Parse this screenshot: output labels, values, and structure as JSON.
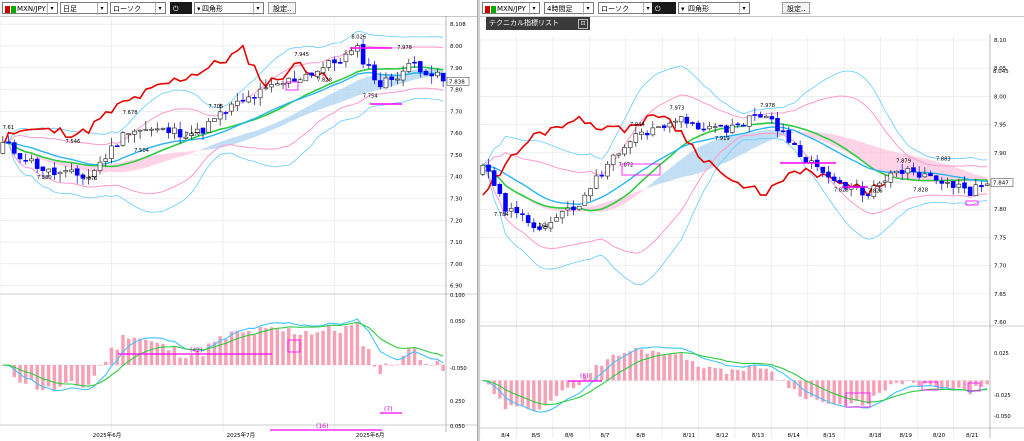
{
  "left": {
    "toolbar": {
      "symbol": "MXN/JPY",
      "timeframe": "日足",
      "chart_style": "ローソク",
      "tool": "四角形",
      "settings_label": "設定.."
    },
    "bottom_labels": [
      "(42)",
      "(16)",
      "(7)"
    ]
  },
  "right": {
    "toolbar": {
      "symbol": "MXN/JPY",
      "timeframe": "4時間足",
      "chart_style": "ローソク",
      "tool": "四角形",
      "settings_label": "設定.."
    },
    "overlay_label": "テクニカル指標リスト",
    "bottom_labels": [
      "(8)"
    ]
  },
  "colors": {
    "up": "#1e1e1e",
    "down": "#0000ff",
    "boll": "#ff99cc",
    "boll2": "#66ccff",
    "green": "#2ecc40",
    "red": "#e60000",
    "cloud": "#a8d0f0",
    "cloud_pink": "#ffc0dd",
    "hist": "#f5a0b4",
    "magenta": "#ff00ff"
  },
  "chart_data": [
    {
      "id": "daily",
      "type": "candlestick",
      "symbol": "MXN/JPY",
      "timeframe": "日足",
      "yticks": [
        8.1,
        8.0,
        7.9,
        7.8,
        7.7,
        7.6,
        7.5,
        7.4,
        7.3,
        7.2,
        7.1,
        7.0,
        6.9
      ],
      "ylabels": [
        "8.108",
        "8.00",
        "7.90",
        "7.80",
        "7.70",
        "7.60",
        "7.50",
        "7.40",
        "7.30",
        "7.20",
        "7.10",
        "7.00",
        "6.90"
      ],
      "last_price": 7.838,
      "last_label": "7.838",
      "x_labels": [
        "2025年6月",
        "2025年7月",
        "2025年8月"
      ],
      "price_annotations": [
        {
          "bar": 1,
          "price": 7.61,
          "label": "7.61"
        },
        {
          "bar": 7,
          "price": 7.38,
          "label": "7.380"
        },
        {
          "bar": 12,
          "price": 7.546,
          "label": "7.546"
        },
        {
          "bar": 15,
          "price": 7.376,
          "label": "7.376"
        },
        {
          "bar": 22,
          "price": 7.678,
          "label": "7.678"
        },
        {
          "bar": 24,
          "price": 7.504,
          "label": "7.504"
        },
        {
          "bar": 33,
          "price": 7.577,
          "label": "7.577"
        },
        {
          "bar": 37,
          "price": 7.705,
          "label": "7.705"
        },
        {
          "bar": 52,
          "price": 7.945,
          "label": "7.945"
        },
        {
          "bar": 56,
          "price": 7.828,
          "label": "7.828"
        },
        {
          "bar": 62,
          "price": 8.026,
          "label": "8.026"
        },
        {
          "bar": 64,
          "price": 7.754,
          "label": "7.754"
        },
        {
          "bar": 70,
          "price": 7.978,
          "label": "7.978"
        }
      ],
      "osc_labels": [
        "0.100",
        "0.050",
        "-0.050",
        "0.250",
        "0.050"
      ]
    },
    {
      "id": "h4",
      "type": "candlestick",
      "symbol": "MXN/JPY",
      "timeframe": "4時間足",
      "yticks": [
        8.1,
        8.05,
        8.0,
        7.95,
        7.9,
        7.85,
        7.8,
        7.75,
        7.7,
        7.65,
        7.6
      ],
      "ylabels": [
        "8.10",
        "8.05",
        "8.00",
        "7.95",
        "7.90",
        "7.85",
        "7.80",
        "7.75",
        "7.70",
        "7.65",
        "7.60"
      ],
      "last_price": 7.847,
      "last_label": "7.847",
      "current_label": "8.045",
      "x_labels": [
        "8/4",
        "8/5",
        "8/6",
        "8/7",
        "8/8",
        "8/11",
        "8/12",
        "8/13",
        "8/14",
        "8/15",
        "8/18",
        "8/19",
        "8/20",
        "8/21"
      ],
      "price_annotations": [
        {
          "bar": 3,
          "price": 7.784,
          "label": "7.784"
        },
        {
          "bar": 10,
          "price": 7.764,
          "label": "7.764"
        },
        {
          "bar": 25,
          "price": 7.872,
          "label": "7.872"
        },
        {
          "bar": 27,
          "price": 7.944,
          "label": "7.944"
        },
        {
          "bar": 34,
          "price": 7.973,
          "label": "7.973"
        },
        {
          "bar": 42,
          "price": 7.919,
          "label": "7.919"
        },
        {
          "bar": 50,
          "price": 7.978,
          "label": "7.978"
        },
        {
          "bar": 63,
          "price": 7.828,
          "label": "7.828"
        },
        {
          "bar": 69,
          "price": 7.826,
          "label": "7.826"
        },
        {
          "bar": 74,
          "price": 7.879,
          "label": "7.879"
        },
        {
          "bar": 77,
          "price": 7.828,
          "label": "7.828"
        },
        {
          "bar": 81,
          "price": 7.883,
          "label": "7.883"
        }
      ],
      "osc_labels": [
        "0.025",
        "-0.025",
        "-0.050"
      ]
    }
  ]
}
